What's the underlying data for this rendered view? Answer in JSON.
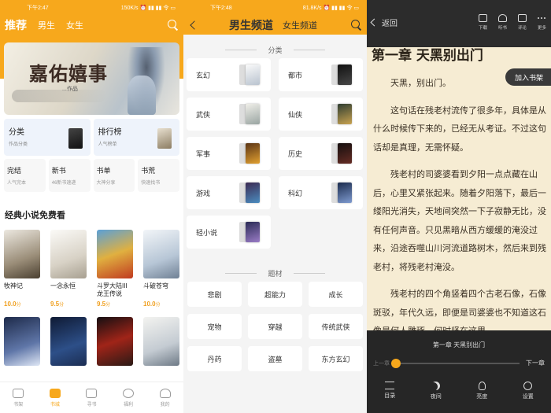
{
  "panel1": {
    "status": {
      "time": "下午2:47",
      "right": "150K/s ⏰ ▮▮ ▮▮ 令 ▭"
    },
    "tabs": [
      "推荐",
      "男生",
      "女生"
    ],
    "banner": {
      "title": "嘉佑嬉事",
      "subtitle": "...作品"
    },
    "cards_top": [
      {
        "title": "分类",
        "subtitle": "作品分类"
      },
      {
        "title": "排行榜",
        "subtitle": "人气榜单"
      }
    ],
    "cards_bottom": [
      {
        "title": "完结",
        "subtitle": "人气完本"
      },
      {
        "title": "新书",
        "subtitle": "46新书速递"
      },
      {
        "title": "书单",
        "subtitle": "大神分享"
      },
      {
        "title": "书荒",
        "subtitle": "快速找书"
      }
    ],
    "section_title": "经典小说免费看",
    "books": [
      {
        "name": "牧神记",
        "score": "10.0",
        "unit": "分"
      },
      {
        "name": "一念永恒",
        "score": "9.5",
        "unit": "分"
      },
      {
        "name": "斗罗大陆III龙王传说",
        "score": "9.5",
        "unit": "分"
      },
      {
        "name": "斗破苍穹",
        "score": "10.0",
        "unit": "分"
      },
      {
        "name": "",
        "score": "",
        "unit": ""
      },
      {
        "name": "",
        "score": "",
        "unit": ""
      },
      {
        "name": "",
        "score": "",
        "unit": ""
      },
      {
        "name": "",
        "score": "",
        "unit": ""
      }
    ],
    "nav": [
      "书架",
      "书城",
      "寻书",
      "福利",
      "我的"
    ]
  },
  "panel2": {
    "status": {
      "time": "下午2:48",
      "right": "81.8K/s ⏰ ▮▮ ▮▮ 令 ▭"
    },
    "tabs": [
      "男生频道",
      "女生频道"
    ],
    "section_category": "分类",
    "categories": [
      "玄幻",
      "都市",
      "武侠",
      "仙侠",
      "军事",
      "历史",
      "游戏",
      "科幻",
      "轻小说"
    ],
    "section_tags": "题材",
    "tags": [
      "悲剧",
      "超能力",
      "成长",
      "宠物",
      "穿越",
      "传统武侠",
      "丹药",
      "盗墓",
      "东方玄幻"
    ]
  },
  "panel3": {
    "back_label": "返回",
    "tools": [
      "下载",
      "听书",
      "评论",
      "更多"
    ],
    "chapter_heading": "第一章 天黑别出门",
    "add_shelf": "加入书架",
    "paragraphs": [
      "天黑，别出门。",
      "这句话在残老村流传了很多年，具体是从什么时候传下来的，已经无从考证。不过这句话却是真理，无需怀疑。",
      "残老村的司婆婆看到夕阳一点点藏在山后，心里又紧张起来。随着夕阳落下，最后一缕阳光消失，天地间突然一下子寂静无比，没有任何声音。只见黑暗从西方缓缓的淹没过来，沿途吞噬山川河流道路树木，然后来到残老村，将残老村淹没。",
      "残老村的四个角竖着四个古老石像，石像斑驳，年代久远，即便是司婆婆也不知道这石像是何人雕琢，何时竖在这里。"
    ],
    "bottom_chapter": "第一章 天黑别出门",
    "prev": "上一章",
    "next": "下一章",
    "progress": 0.0,
    "nav": [
      "目录",
      "夜间",
      "亮度",
      "设置"
    ]
  }
}
